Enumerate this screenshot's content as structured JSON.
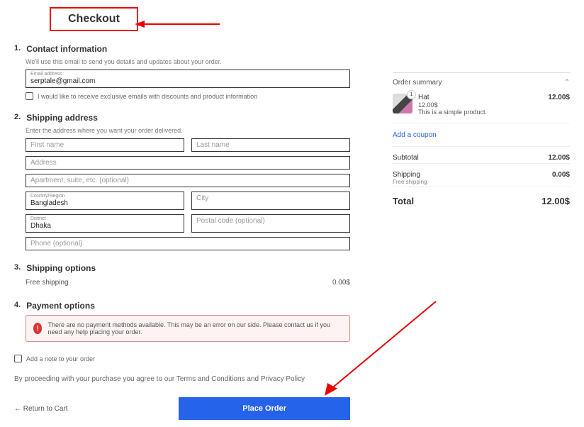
{
  "title": "Checkout",
  "contact": {
    "heading": "Contact information",
    "hint": "We'll use this email to send you details and updates about your order.",
    "email_label": "Email address",
    "email_value": "serptale@gmail.com",
    "optin": "I would like to receive exclusive emails with discounts and product information"
  },
  "shipping": {
    "heading": "Shipping address",
    "hint": "Enter the address where you want your order delivered.",
    "first_name_ph": "First name",
    "last_name_ph": "Last name",
    "address_ph": "Address",
    "apt_ph": "Apartment, suite, etc. (optional)",
    "country_label": "Country/Region",
    "country_value": "Bangladesh",
    "city_ph": "City",
    "district_label": "District",
    "district_value": "Dhaka",
    "postal_ph": "Postal code (optional)",
    "phone_ph": "Phone (optional)"
  },
  "ship_opts": {
    "heading": "Shipping options",
    "method": "Free shipping",
    "price": "0.00$"
  },
  "payment": {
    "heading": "Payment options",
    "error": "There are no payment methods available. This may be an error on our side. Please contact us if you need any help placing your order."
  },
  "note_label": "Add a note to your order",
  "terms_pre": "By proceeding with your purchase you agree to our ",
  "terms1": "Terms and Conditions",
  "terms_mid": " and ",
  "terms2": "Privacy Policy",
  "return_label": "Return to Cart",
  "place_label": "Place Order",
  "summary": {
    "heading": "Order summary",
    "item_name": "Hat",
    "item_qty": "1",
    "item_price_line": "12.00$",
    "item_desc": "This is a simple product.",
    "item_price": "12.00$",
    "coupon": "Add a coupon",
    "subtotal_label": "Subtotal",
    "subtotal_val": "12.00$",
    "ship_label": "Shipping",
    "ship_sub": "Free shipping",
    "ship_val": "0.00$",
    "total_label": "Total",
    "total_val": "12.00$"
  }
}
